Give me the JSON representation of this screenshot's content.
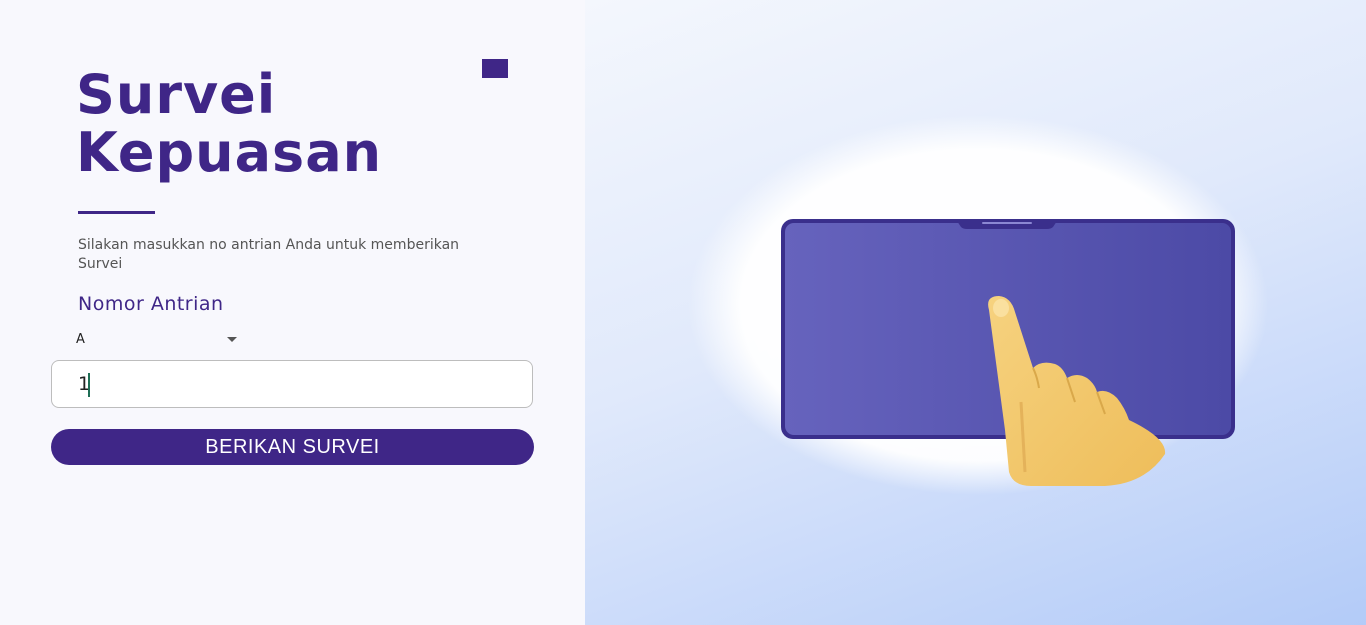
{
  "survey": {
    "title_line1": "Survei",
    "title_line2": "Kepuasan",
    "subtitle": "Silakan masukkan no antrian Anda untuk memberikan Survei",
    "field_label": "Nomor Antrian",
    "prefix_select_value": "A",
    "queue_number_value": "1",
    "submit_label": "BERIKAN SURVEI"
  },
  "illustration": {
    "subject": "hand-tapping-tablet",
    "tablet_color": "#5a56b4",
    "hand_color": "#f3c86a"
  },
  "colors": {
    "brand": "#3f2687",
    "left_background": "#f8f8fd",
    "right_background": "#b3cbf8"
  }
}
